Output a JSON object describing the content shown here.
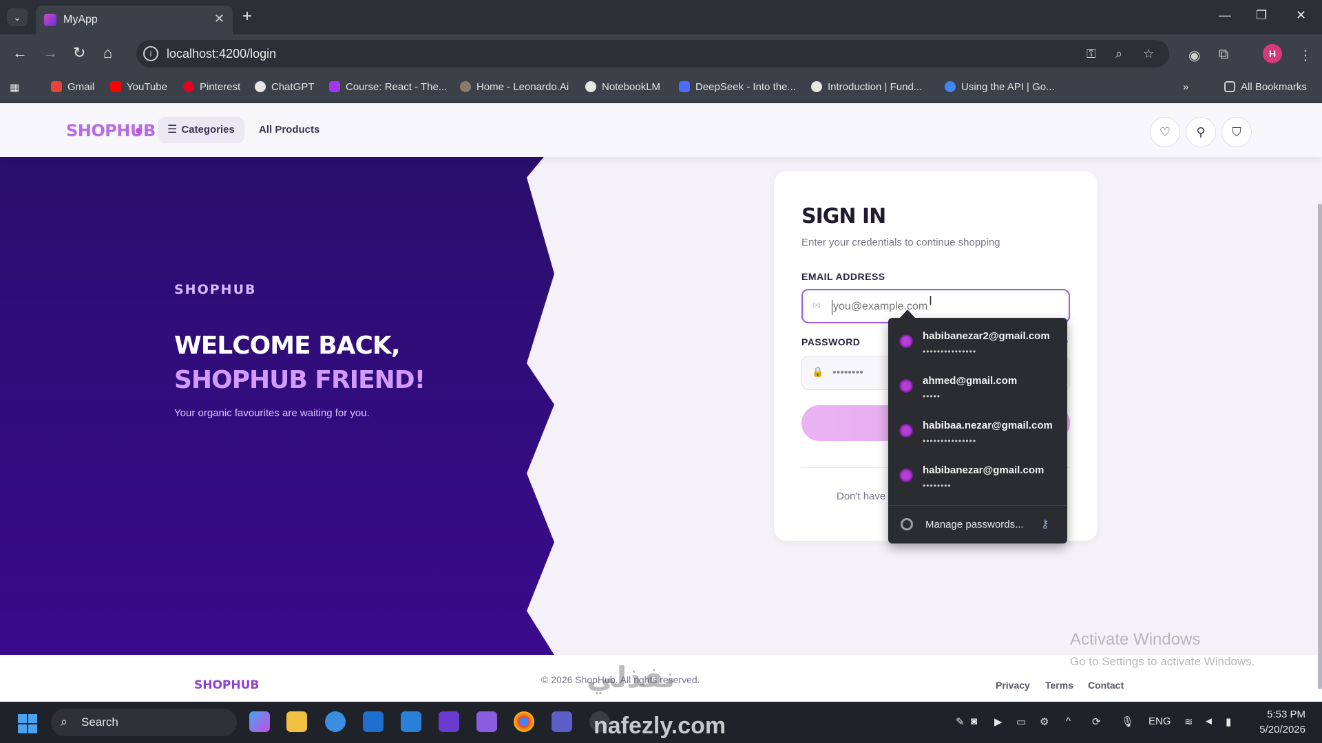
{
  "browser": {
    "tab_title": "MyApp",
    "url": "localhost:4200/login",
    "bookmarks": [
      "Gmail",
      "YouTube",
      "Pinterest",
      "ChatGPT",
      "Course: React - The...",
      "Home - Leonardo.Ai",
      "NotebookLM",
      "DeepSeek - Into the...",
      "Introduction | Fund...",
      "Using the API | Go..."
    ],
    "all_bookmarks": "All Bookmarks",
    "profile_initial": "H"
  },
  "header": {
    "logo": "SHOPHUB",
    "categories": "Categories",
    "all_products": "All Products"
  },
  "hero": {
    "brand": "SHOPHUB",
    "line1": "WELCOME BACK,",
    "line2": "SHOPHUB FRIEND!",
    "subtitle": "Your organic favourites are waiting for you."
  },
  "signin": {
    "title": "SIGN IN",
    "subtitle": "Enter your credentials to continue shopping",
    "email_label": "EMAIL ADDRESS",
    "email_placeholder": "you@example.com",
    "password_label": "PASSWORD",
    "password_value": "••••••••",
    "forgot_fragment": "?",
    "dont_have": "Don't have"
  },
  "autofill": {
    "suggestions": [
      {
        "email": "habibanezar2@gmail.com",
        "dots": "•••••••••••••••"
      },
      {
        "email": "ahmed@gmail.com",
        "dots": "•••••"
      },
      {
        "email": "habibaa.nezar@gmail.com",
        "dots": "•••••••••••••••"
      },
      {
        "email": "habibanezar@gmail.com",
        "dots": "••••••••"
      }
    ],
    "manage": "Manage passwords..."
  },
  "footer": {
    "logo": "SHOPHUB",
    "copyright": "© 2026 ShopHub. All rights reserved.",
    "links": [
      "Privacy",
      "Terms",
      "Contact"
    ]
  },
  "activate": {
    "line1": "Activate Windows",
    "line2": "Go to Settings to activate Windows."
  },
  "watermark": {
    "arabic": "نفذلي",
    "latin": "nafezly.com"
  },
  "taskbar": {
    "search": "Search",
    "lang": "ENG",
    "time": "5:53 PM",
    "date": "5/20/2026"
  },
  "colors": {
    "hero_bg_top": "#2a0f6e",
    "hero_bg_bottom": "#3a0a8c",
    "accent": "#a05ae0",
    "logo": "#b56ce6"
  }
}
